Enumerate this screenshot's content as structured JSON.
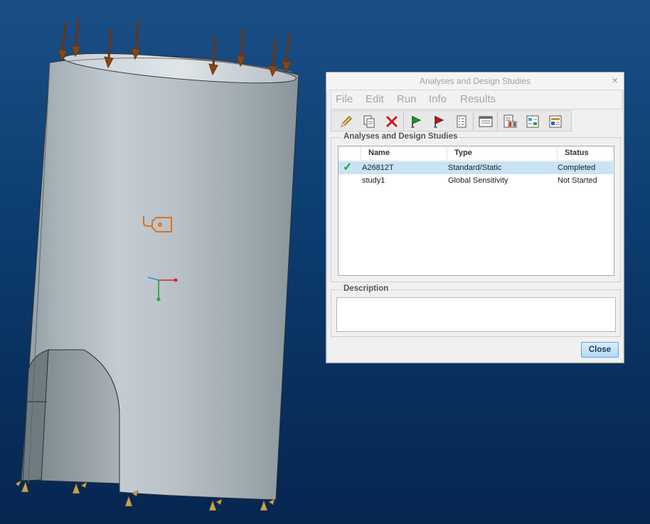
{
  "dialog": {
    "title": "Analyses and Design Studies",
    "close_glyph": "×",
    "menu": [
      "File",
      "Edit",
      "Run",
      "Info",
      "Results"
    ],
    "toolbar_icons": [
      "pencil-icon",
      "copy-icon",
      "delete-icon",
      "start-flag-icon",
      "stop-flag-icon",
      "status-list-icon",
      "info-panel-icon",
      "results-icon",
      "compare-icon",
      "export-icon"
    ],
    "list_group_label": "Analyses and Design Studies",
    "columns": [
      "Name",
      "Type",
      "Status"
    ],
    "rows": [
      {
        "name": "A26812T",
        "type": "Standard/Static",
        "status": "Completed",
        "selected": true,
        "check": "✓"
      },
      {
        "name": "study1",
        "type": "Global Sensitivity",
        "status": "Not Started",
        "selected": false,
        "check": ""
      }
    ],
    "description_label": "Description",
    "description_value": "",
    "close_label": "Close"
  },
  "colors": {
    "background_top": "#1a4f86",
    "background_bottom": "#062650",
    "selection": "#c8e3f4",
    "load_arrow": "#8b4513",
    "constraint": "#c8a052",
    "tag": "#e0701a"
  }
}
